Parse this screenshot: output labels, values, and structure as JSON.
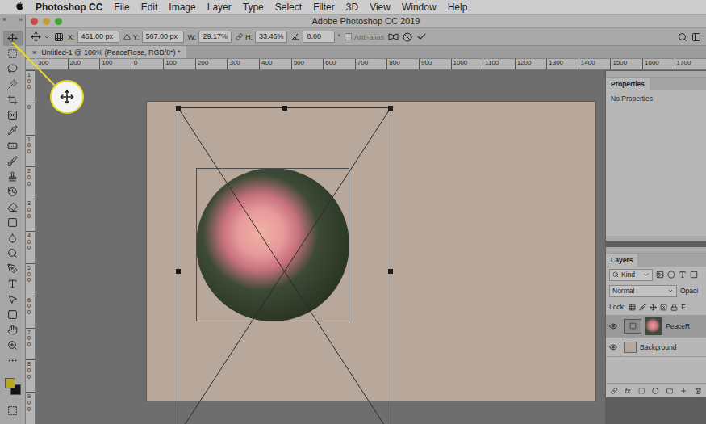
{
  "menu_bar": {
    "app_name": "Photoshop CC",
    "items": [
      "File",
      "Edit",
      "Image",
      "Layer",
      "Type",
      "Select",
      "Filter",
      "3D",
      "View",
      "Window",
      "Help"
    ]
  },
  "window": {
    "title": "Adobe Photoshop CC 2019"
  },
  "toolbar": {
    "header": [
      "×",
      "»"
    ],
    "tools": [
      {
        "selected": true
      },
      {
        "selected": false
      },
      {
        "selected": false
      },
      {
        "selected": false
      },
      {
        "selected": false
      },
      {
        "selected": false
      },
      {
        "selected": false
      },
      {
        "selected": false
      },
      {
        "selected": false
      },
      {
        "selected": false
      },
      {
        "selected": false
      },
      {
        "selected": false
      },
      {
        "selected": false
      },
      {
        "selected": false
      },
      {
        "selected": false
      },
      {
        "selected": false
      },
      {
        "selected": false
      },
      {
        "selected": false
      },
      {
        "selected": false
      },
      {
        "selected": false
      },
      {
        "selected": false
      },
      {
        "selected": false
      }
    ],
    "foreground_color": "#b7a81c",
    "background_color": "#141414"
  },
  "options_bar": {
    "fields": [
      {
        "label": "X:",
        "value": "461.00 px"
      },
      {
        "label": "Y:",
        "value": "567.00 px"
      },
      {
        "label": "W:",
        "value": "29.17%"
      },
      {
        "label": "H:",
        "value": "33.46%"
      }
    ],
    "angle": {
      "value": "0.00",
      "unit": "°"
    },
    "anti_alias": {
      "label": "Anti-alias",
      "checked": false,
      "disabled": true
    }
  },
  "document_tab": {
    "close": "×",
    "label": "Untitled-1 @ 100% (PeaceRose, RGB/8*) *",
    "selected": true
  },
  "rulers": {
    "horizontal": [
      "300",
      "200",
      "100",
      "0",
      "100",
      "200",
      "300",
      "400",
      "500",
      "600",
      "700",
      "800",
      "900",
      "1000",
      "1100",
      "1200",
      "1300",
      "1400",
      "1500",
      "1600",
      "1700"
    ],
    "vertical": [
      "100",
      "0",
      "100",
      "200",
      "300",
      "400",
      "500",
      "600",
      "700",
      "800",
      "900"
    ]
  },
  "properties_panel": {
    "title": "Properties",
    "message": "No Properties"
  },
  "layers_panel": {
    "title": "Layers",
    "filter": "Kind",
    "blend_mode": "Normal",
    "opacity_label": "Opaci",
    "lock_label": "Lock:",
    "fill_label": "F",
    "footer_fx": "fx",
    "layers": [
      {
        "name": "PeaceR",
        "kind": "smart",
        "visible": true,
        "selected": true,
        "color": "#3d4a3a"
      },
      {
        "name": "Background",
        "kind": "pixel",
        "visible": true,
        "selected": false,
        "color": "#b8a89c"
      }
    ]
  }
}
